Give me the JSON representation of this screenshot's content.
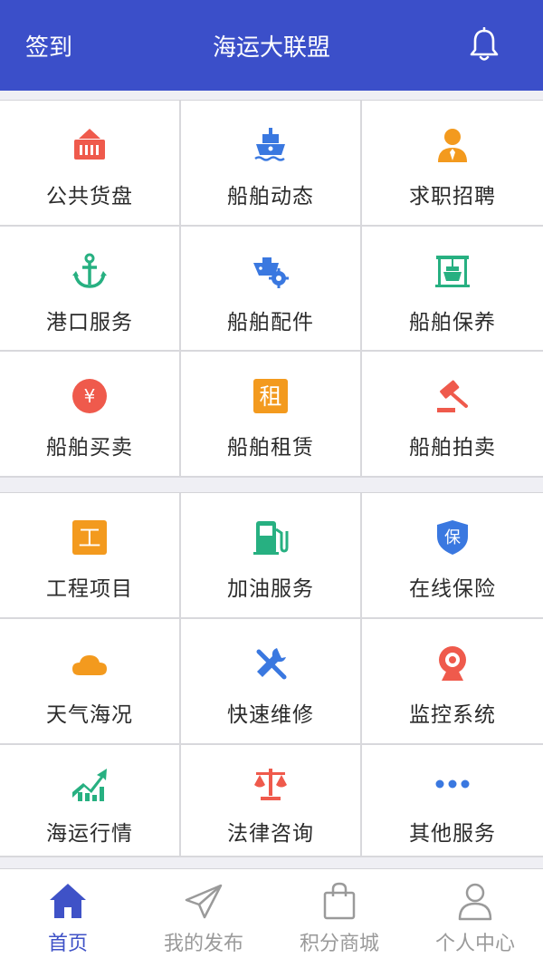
{
  "header": {
    "checkin_label": "签到",
    "title": "海运大联盟",
    "bell_icon": "bell-icon"
  },
  "colors": {
    "primary": "#3b4fc9",
    "red": "#ef5a4c",
    "blue": "#3a78e0",
    "orange": "#f39a1e",
    "green": "#27b081"
  },
  "grid1": [
    {
      "label": "公共货盘",
      "icon": "container-icon"
    },
    {
      "label": "船舶动态",
      "icon": "ship-icon"
    },
    {
      "label": "求职招聘",
      "icon": "person-icon"
    },
    {
      "label": "港口服务",
      "icon": "anchor-icon"
    },
    {
      "label": "船舶配件",
      "icon": "ship-gear-icon"
    },
    {
      "label": "船舶保养",
      "icon": "maintenance-icon"
    },
    {
      "label": "船舶买卖",
      "icon": "yuan-icon"
    },
    {
      "label": "船舶租赁",
      "icon": "rent-icon",
      "glyph": "租"
    },
    {
      "label": "船舶拍卖",
      "icon": "gavel-icon"
    }
  ],
  "grid2": [
    {
      "label": "工程项目",
      "icon": "engineering-icon",
      "glyph": "工"
    },
    {
      "label": "加油服务",
      "icon": "fuel-icon"
    },
    {
      "label": "在线保险",
      "icon": "shield-icon",
      "glyph": "保"
    },
    {
      "label": "天气海况",
      "icon": "cloud-icon"
    },
    {
      "label": "快速维修",
      "icon": "tools-icon"
    },
    {
      "label": "监控系统",
      "icon": "camera-icon"
    },
    {
      "label": "海运行情",
      "icon": "chart-icon"
    },
    {
      "label": "法律咨询",
      "icon": "scale-icon"
    },
    {
      "label": "其他服务",
      "icon": "more-icon"
    }
  ],
  "tabs": [
    {
      "label": "首页",
      "icon": "home-icon",
      "active": true
    },
    {
      "label": "我的发布",
      "icon": "paper-plane-icon",
      "active": false
    },
    {
      "label": "积分商城",
      "icon": "shopping-bag-icon",
      "active": false
    },
    {
      "label": "个人中心",
      "icon": "user-icon",
      "active": false
    }
  ]
}
